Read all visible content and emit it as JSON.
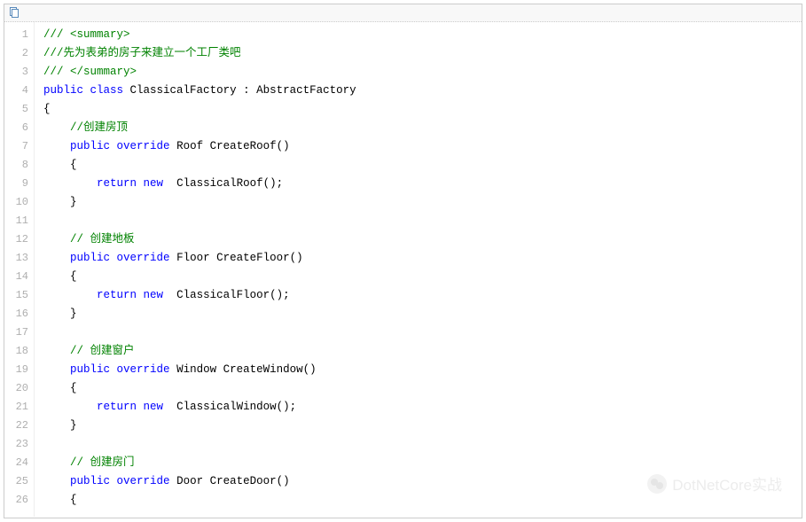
{
  "watermark": {
    "text": "DotNetCore实战"
  },
  "code": {
    "lines": [
      {
        "n": 1,
        "indent": 0,
        "tokens": [
          {
            "t": "/// <summary>",
            "c": "comment"
          }
        ]
      },
      {
        "n": 2,
        "indent": 0,
        "tokens": [
          {
            "t": "///先为表弟的房子来建立一个工厂类吧",
            "c": "comment"
          }
        ]
      },
      {
        "n": 3,
        "indent": 0,
        "tokens": [
          {
            "t": "/// </summary>",
            "c": "comment"
          }
        ]
      },
      {
        "n": 4,
        "indent": 0,
        "tokens": [
          {
            "t": "public",
            "c": "keyword"
          },
          {
            "t": " ",
            "c": "plain"
          },
          {
            "t": "class",
            "c": "keyword"
          },
          {
            "t": " ClassicalFactory : AbstractFactory",
            "c": "plain"
          }
        ]
      },
      {
        "n": 5,
        "indent": 0,
        "tokens": [
          {
            "t": "{",
            "c": "plain"
          }
        ]
      },
      {
        "n": 6,
        "indent": 1,
        "tokens": [
          {
            "t": "//创建房顶",
            "c": "comment"
          }
        ]
      },
      {
        "n": 7,
        "indent": 1,
        "tokens": [
          {
            "t": "public",
            "c": "keyword"
          },
          {
            "t": " ",
            "c": "plain"
          },
          {
            "t": "override",
            "c": "keyword"
          },
          {
            "t": " Roof CreateRoof()",
            "c": "plain"
          }
        ]
      },
      {
        "n": 8,
        "indent": 1,
        "tokens": [
          {
            "t": "{",
            "c": "plain"
          }
        ]
      },
      {
        "n": 9,
        "indent": 2,
        "tokens": [
          {
            "t": "return",
            "c": "keyword"
          },
          {
            "t": " ",
            "c": "plain"
          },
          {
            "t": "new",
            "c": "keyword"
          },
          {
            "t": "  ClassicalRoof();",
            "c": "plain"
          }
        ]
      },
      {
        "n": 10,
        "indent": 1,
        "tokens": [
          {
            "t": "}",
            "c": "plain"
          }
        ]
      },
      {
        "n": 11,
        "indent": 0,
        "tokens": []
      },
      {
        "n": 12,
        "indent": 1,
        "tokens": [
          {
            "t": "// 创建地板",
            "c": "comment"
          }
        ]
      },
      {
        "n": 13,
        "indent": 1,
        "tokens": [
          {
            "t": "public",
            "c": "keyword"
          },
          {
            "t": " ",
            "c": "plain"
          },
          {
            "t": "override",
            "c": "keyword"
          },
          {
            "t": " Floor CreateFloor()",
            "c": "plain"
          }
        ]
      },
      {
        "n": 14,
        "indent": 1,
        "tokens": [
          {
            "t": "{",
            "c": "plain"
          }
        ]
      },
      {
        "n": 15,
        "indent": 2,
        "tokens": [
          {
            "t": "return",
            "c": "keyword"
          },
          {
            "t": " ",
            "c": "plain"
          },
          {
            "t": "new",
            "c": "keyword"
          },
          {
            "t": "  ClassicalFloor();",
            "c": "plain"
          }
        ]
      },
      {
        "n": 16,
        "indent": 1,
        "tokens": [
          {
            "t": "}",
            "c": "plain"
          }
        ]
      },
      {
        "n": 17,
        "indent": 0,
        "tokens": []
      },
      {
        "n": 18,
        "indent": 1,
        "tokens": [
          {
            "t": "// 创建窗户",
            "c": "comment"
          }
        ]
      },
      {
        "n": 19,
        "indent": 1,
        "tokens": [
          {
            "t": "public",
            "c": "keyword"
          },
          {
            "t": " ",
            "c": "plain"
          },
          {
            "t": "override",
            "c": "keyword"
          },
          {
            "t": " Window CreateWindow()",
            "c": "plain"
          }
        ]
      },
      {
        "n": 20,
        "indent": 1,
        "tokens": [
          {
            "t": "{",
            "c": "plain"
          }
        ]
      },
      {
        "n": 21,
        "indent": 2,
        "tokens": [
          {
            "t": "return",
            "c": "keyword"
          },
          {
            "t": " ",
            "c": "plain"
          },
          {
            "t": "new",
            "c": "keyword"
          },
          {
            "t": "  ClassicalWindow();",
            "c": "plain"
          }
        ]
      },
      {
        "n": 22,
        "indent": 1,
        "tokens": [
          {
            "t": "}",
            "c": "plain"
          }
        ]
      },
      {
        "n": 23,
        "indent": 0,
        "tokens": []
      },
      {
        "n": 24,
        "indent": 1,
        "tokens": [
          {
            "t": "// 创建房门",
            "c": "comment"
          }
        ]
      },
      {
        "n": 25,
        "indent": 1,
        "tokens": [
          {
            "t": "public",
            "c": "keyword"
          },
          {
            "t": " ",
            "c": "plain"
          },
          {
            "t": "override",
            "c": "keyword"
          },
          {
            "t": " Door CreateDoor()",
            "c": "plain"
          }
        ]
      },
      {
        "n": 26,
        "indent": 1,
        "tokens": [
          {
            "t": "{",
            "c": "plain"
          }
        ]
      }
    ],
    "indent_unit": "    "
  }
}
